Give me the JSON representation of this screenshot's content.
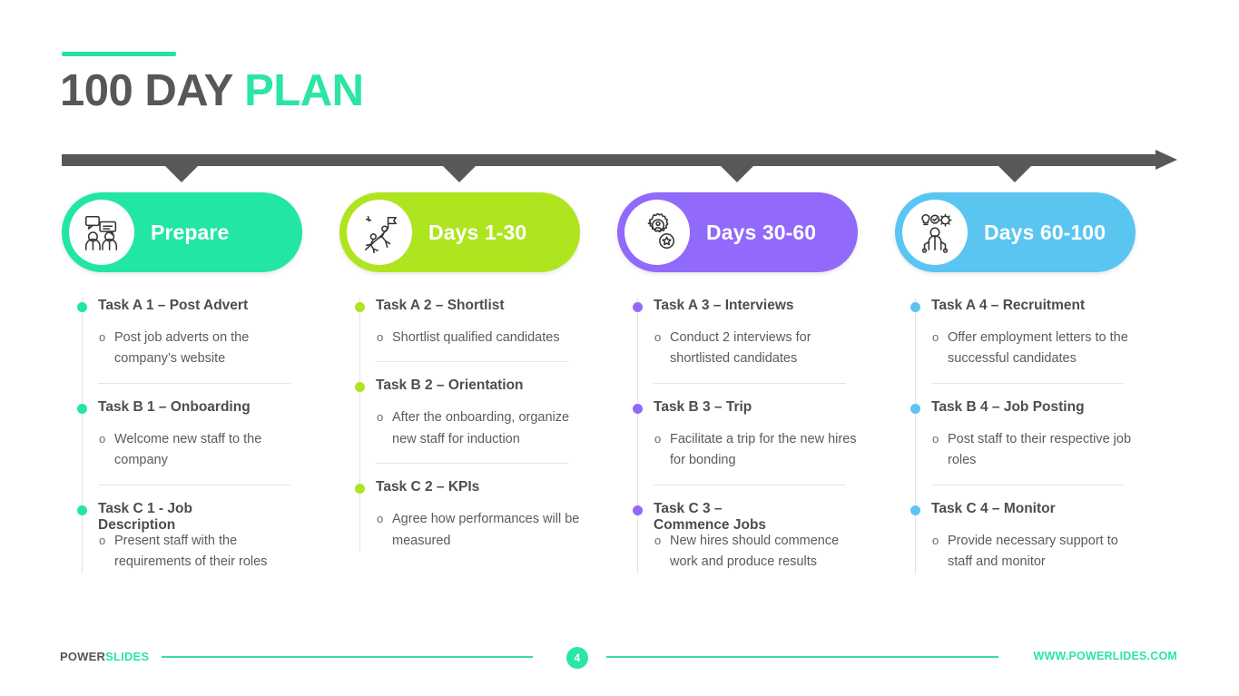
{
  "title": {
    "primary": "100 DAY",
    "accent": "PLAN"
  },
  "colors": {
    "green": "#22E6A4",
    "lime": "#AEE51F",
    "purple": "#9169FB",
    "blue": "#5BC5F2",
    "timeline": "#58585a",
    "title_dark": "#57575a"
  },
  "columns": [
    {
      "label": "Prepare",
      "color": "#22E6A4",
      "icon": "meeting-people-icon",
      "tasks": [
        {
          "heading": "Task A 1 – Post Advert",
          "detail": "Post job adverts on the company’s website"
        },
        {
          "heading": "Task B 1 – Onboarding",
          "detail": "Welcome new staff to the company"
        },
        {
          "heading": "Task C 1 - Job Description",
          "detail": "Present staff with the requirements of their roles"
        }
      ]
    },
    {
      "label": "Days 1-30",
      "color": "#AEE51F",
      "icon": "climbing-teamwork-icon",
      "tasks": [
        {
          "heading": "Task A 2 – Shortlist",
          "detail": "Shortlist qualified candidates"
        },
        {
          "heading": "Task B 2 – Orientation",
          "detail": "After the onboarding, organize new staff for induction"
        },
        {
          "heading": "Task C 2 – KPIs",
          "detail": "Agree how performances will be measured"
        }
      ]
    },
    {
      "label": "Days 30-60",
      "color": "#9169FB",
      "icon": "gear-person-star-icon",
      "tasks": [
        {
          "heading": "Task A 3 – Interviews",
          "detail": "Conduct 2 interviews for shortlisted candidates"
        },
        {
          "heading": "Task B 3 – Trip",
          "detail": "Facilitate a trip for the new hires for bonding"
        },
        {
          "heading": "Task C 3 – Commence Jobs",
          "detail": "New hires should commence work and produce results"
        }
      ]
    },
    {
      "label": "Days 60-100",
      "color": "#5BC5F2",
      "icon": "skills-person-idea-icon",
      "tasks": [
        {
          "heading": "Task A 4 – Recruitment",
          "detail": "Offer employment letters to the successful candidates"
        },
        {
          "heading": "Task B 4 – Job Posting",
          "detail": "Post staff to their respective job roles"
        },
        {
          "heading": "Task C 4 – Monitor",
          "detail": "Provide necessary support to staff and monitor"
        }
      ]
    }
  ],
  "sub_marker": "o",
  "footer": {
    "brand_primary": "POWER",
    "brand_accent": "SLIDES",
    "page_number": "4",
    "url": "WWW.POWERLIDES.COM"
  }
}
